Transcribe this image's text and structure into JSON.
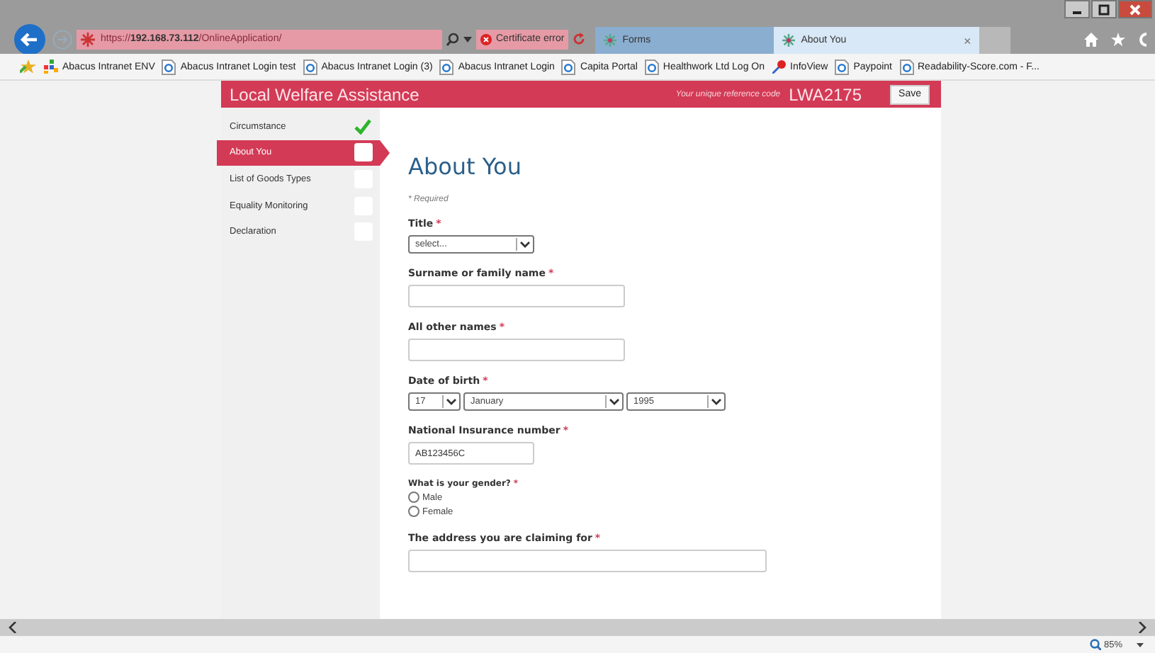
{
  "browser": {
    "url_scheme": "https://",
    "url_host": "192.168.73.112",
    "url_path": "/OnlineApplication/",
    "certificate_label": "Certificate error",
    "tabs": [
      {
        "label": "Forms",
        "selected": false
      },
      {
        "label": "About You",
        "selected": true,
        "close": "×"
      }
    ],
    "favorites": [
      {
        "label": "Abacus Intranet ENV",
        "kind": "tiles"
      },
      {
        "label": "Abacus Intranet Login  test",
        "kind": "page"
      },
      {
        "label": "Abacus Intranet Login (3)",
        "kind": "page"
      },
      {
        "label": "Abacus Intranet Login",
        "kind": "page"
      },
      {
        "label": "Capita Portal",
        "kind": "page"
      },
      {
        "label": "Healthwork Ltd Log On",
        "kind": "page"
      },
      {
        "label": "InfoView",
        "kind": "pin"
      },
      {
        "label": "Paypoint",
        "kind": "page"
      },
      {
        "label": "Readability-Score.com - F...",
        "kind": "page"
      }
    ],
    "zoom": "85%"
  },
  "app": {
    "title": "Local Welfare Assistance",
    "reference_label": "Your unique reference code",
    "reference_code": "LWA2175",
    "save": "Save"
  },
  "steps": [
    {
      "label": "Circumstance",
      "selected": false,
      "completed": true
    },
    {
      "label": "About You",
      "selected": true,
      "completed": false
    },
    {
      "label": "List of Goods Types",
      "selected": false,
      "completed": false
    },
    {
      "label": "Equality Monitoring",
      "selected": false,
      "completed": false
    },
    {
      "label": "Declaration",
      "selected": false,
      "completed": false
    }
  ],
  "form": {
    "heading": "About You",
    "required_note": "* Required",
    "fields": [
      {
        "kind": "select",
        "label": "Title",
        "required_mark": "*",
        "value": "select..."
      },
      {
        "kind": "text",
        "label": "Surname or family name",
        "required_mark": "*"
      },
      {
        "kind": "text",
        "label": "All other names",
        "required_mark": "*"
      },
      {
        "kind": "date",
        "label": "Date of birth",
        "required_mark": "*",
        "parts": [
          "17",
          "January",
          "1995"
        ]
      },
      {
        "kind": "short",
        "label": "National Insurance number",
        "required_mark": "*",
        "value": "AB123456C"
      },
      {
        "kind": "radio",
        "label": "What is your gender?",
        "required_mark": "*",
        "options": [
          {
            "label": "Male",
            "selected": false
          },
          {
            "label": "Female",
            "selected": false
          }
        ]
      },
      {
        "kind": "wide",
        "label": "The address you are claiming for",
        "required_mark": "*"
      }
    ]
  }
}
